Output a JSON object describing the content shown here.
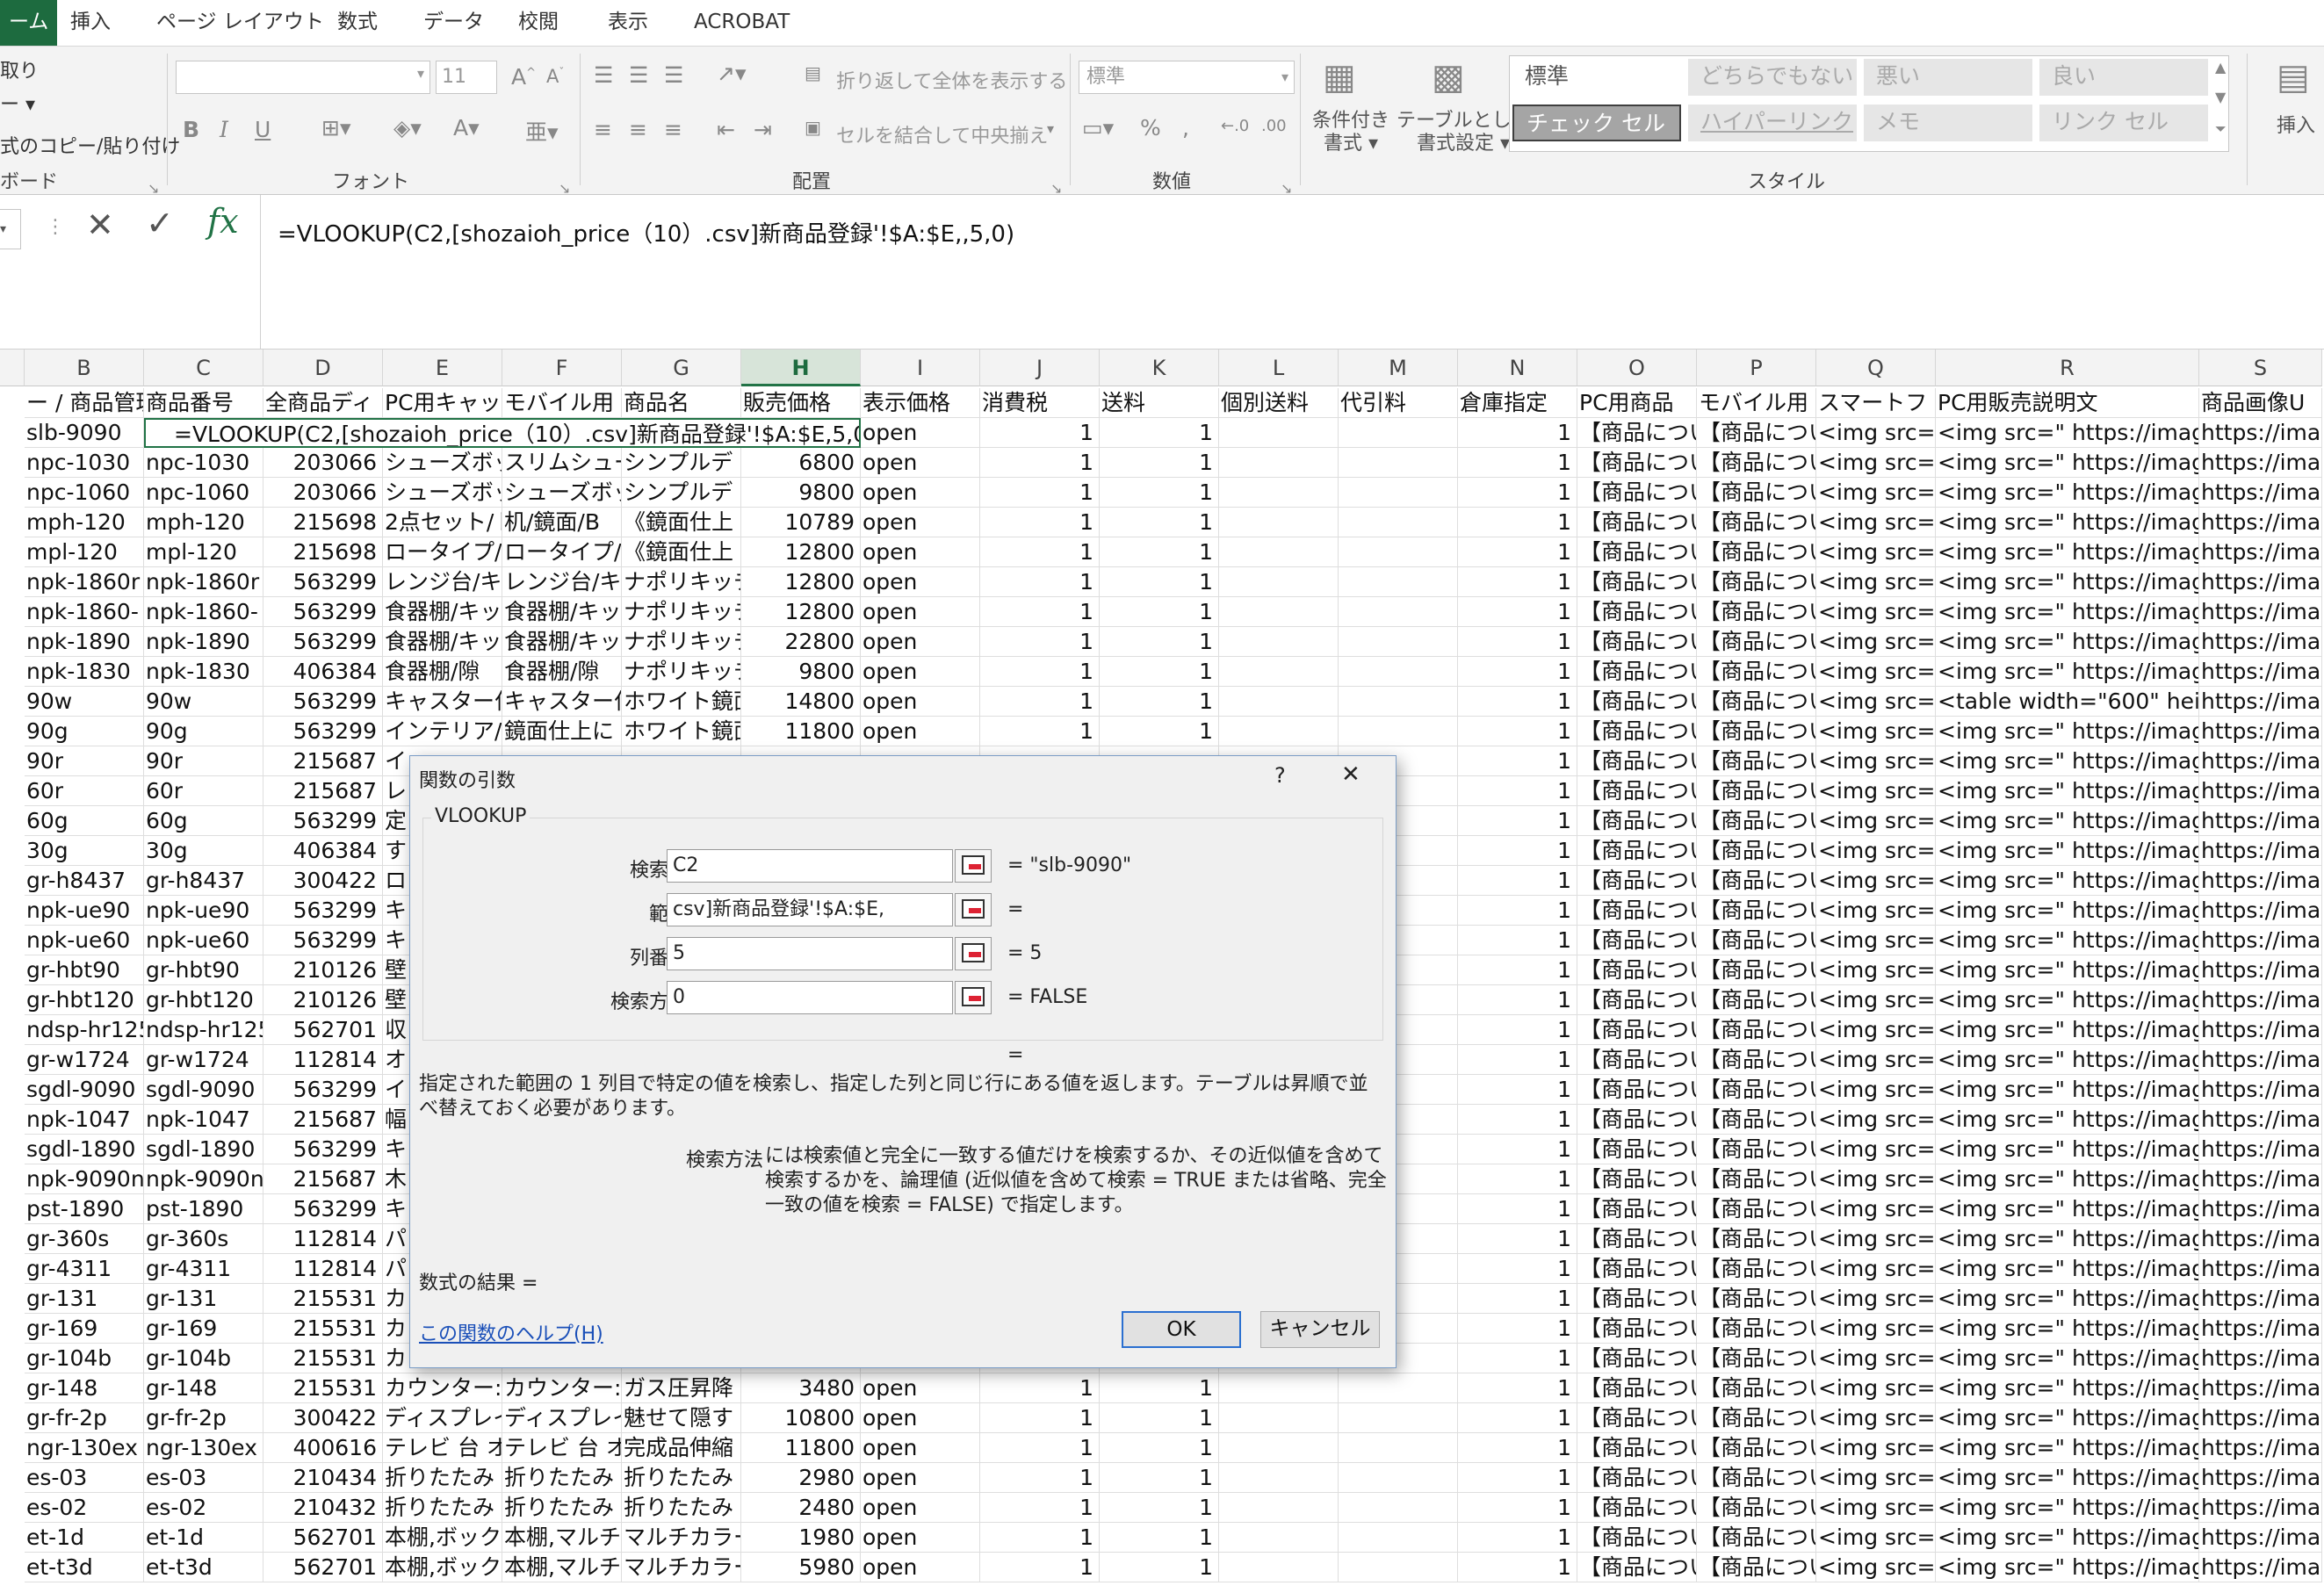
{
  "ribbon": {
    "tabs": [
      {
        "label": "ーム",
        "active": true
      },
      {
        "label": "挿入"
      },
      {
        "label": "ページ レイアウト"
      },
      {
        "label": "数式"
      },
      {
        "label": "データ"
      },
      {
        "label": "校閲"
      },
      {
        "label": "表示"
      },
      {
        "label": "ACROBAT"
      }
    ],
    "clipboard": {
      "cut": "取り",
      "copy": "ー ▾",
      "format_painter": "式のコピー/貼り付け",
      "group": "ボード"
    },
    "font": {
      "font_size": "11",
      "group": "フォント"
    },
    "alignment": {
      "wrap_text": "折り返して全体を表示する",
      "merge_center": "セルを結合して中央揃え",
      "group": "配置"
    },
    "number": {
      "format": "標準",
      "group": "数値"
    },
    "styles": {
      "conditional_formatting": "条件付き\n書式 ▾",
      "format_as_table": "テーブルとして\n書式設定 ▾",
      "cells": [
        "標準",
        "どちらでもない",
        "悪い",
        "良い",
        "チェック セル",
        "ハイパーリンク",
        "メモ",
        "リンク セル"
      ],
      "group": "スタイル"
    },
    "insert": "挿入",
    "colors": {
      "accent": "#217346",
      "bad_bg": "#ffc7ce",
      "good_bg": "#c6efce",
      "check_bg": "#a5a5a5",
      "neutral_bg": "#ffeb9c"
    }
  },
  "formula_bar": {
    "formula": "=VLOOKUP(C2,[shozaioh_price（10）.csv]新商品登録'!$A:$E,,5,0)"
  },
  "sheet": {
    "columns": [
      "B",
      "C",
      "D",
      "E",
      "F",
      "G",
      "H",
      "I",
      "J",
      "K",
      "L",
      "M",
      "N",
      "O",
      "P",
      "Q",
      "R",
      "S"
    ],
    "selected_column": "H",
    "header_row": [
      "ー / 商品管理番",
      "商品番号",
      "全商品ディ",
      "PC用キャッ",
      "モバイル用",
      "商品名",
      "販売価格",
      "表示価格",
      "消費税",
      "送料",
      "個別送料",
      "代引料",
      "倉庫指定",
      "PC用商品",
      "モバイル用",
      "スマートフ",
      "PC用販売説明文",
      "商品画像U"
    ],
    "editing_cell": "=VLOOKUP(C2,[shozaioh_price（10）.csv]新商品登録'!$A:$E,5,0)",
    "rows": [
      [
        "slb-9090",
        "",
        "",
        "",
        "",
        "",
        "",
        "open",
        "1",
        "1",
        "",
        "",
        "1",
        "【商品につい",
        "【商品につい",
        "<img src=\"",
        "<img src=\" https://image",
        "https://ima"
      ],
      [
        "npc-1030",
        "npc-1030",
        "203066",
        "シューズボッ",
        "スリムシュー",
        "シンプルデ",
        "6800",
        "open",
        "1",
        "1",
        "",
        "",
        "1",
        "【商品につい",
        "【商品につい",
        "<img src=\"",
        "<img src=\" https://image",
        "https://ima"
      ],
      [
        "npc-1060",
        "npc-1060",
        "203066",
        "シューズボッ",
        "シューズボッ",
        "シンプルデ",
        "9800",
        "open",
        "1",
        "1",
        "",
        "",
        "1",
        "【商品につい",
        "【商品につい",
        "<img src=\"",
        "<img src=\" https://image",
        "https://ima"
      ],
      [
        "mph-120",
        "mph-120",
        "215698",
        "2点セット/ト",
        "机/鏡面/B",
        "《鏡面仕上",
        "10789",
        "open",
        "1",
        "1",
        "",
        "",
        "1",
        "【商品につい",
        "【商品につい",
        "<img src=\"",
        "<img src=\" https://image",
        "https://ima"
      ],
      [
        "mpl-120",
        "mpl-120",
        "215698",
        "ロータイプ/",
        "ロータイプ/",
        "《鏡面仕上",
        "12800",
        "open",
        "1",
        "1",
        "",
        "",
        "1",
        "【商品につい",
        "【商品につい",
        "<img src=\"",
        "<img src=\" https://image",
        "https://ima"
      ],
      [
        "npk-1860r",
        "npk-1860r",
        "563299",
        "レンジ台/キ",
        "レンジ台/キ",
        "ナポリキッチ",
        "12800",
        "open",
        "1",
        "1",
        "",
        "",
        "1",
        "【商品につい",
        "【商品につい",
        "<img src=\"",
        "<img src=\" https://image",
        "https://ima"
      ],
      [
        "npk-1860-",
        "npk-1860-",
        "563299",
        "食器棚/キッ",
        "食器棚/キッ",
        "ナポリキッチ",
        "12800",
        "open",
        "1",
        "1",
        "",
        "",
        "1",
        "【商品につい",
        "【商品につい",
        "<img src=\"",
        "<img src=\" https://image",
        "https://ima"
      ],
      [
        "npk-1890",
        "npk-1890",
        "563299",
        "食器棚/キッ",
        "食器棚/キッ",
        "ナポリキッチ",
        "22800",
        "open",
        "1",
        "1",
        "",
        "",
        "1",
        "【商品につい",
        "【商品につい",
        "<img src=\"",
        "<img src=\" https://image",
        "https://ima"
      ],
      [
        "npk-1830",
        "npk-1830",
        "406384",
        "食器棚/隙",
        "食器棚/隙",
        "ナポリキッチ",
        "9800",
        "open",
        "1",
        "1",
        "",
        "",
        "1",
        "【商品につい",
        "【商品につい",
        "<img src=\"",
        "<img src=\" https://image",
        "https://ima"
      ],
      [
        "90w",
        "90w",
        "563299",
        "キャスター付",
        "キャスター付",
        "ホワイト鏡面",
        "14800",
        "open",
        "1",
        "1",
        "",
        "",
        "1",
        "【商品につい",
        "【商品につい",
        "<img src=\"",
        "<table width=\"600\" heig",
        "https://ima"
      ],
      [
        "90g",
        "90g",
        "563299",
        "インテリア/",
        "鏡面仕上に",
        "ホワイト鏡面",
        "11800",
        "open",
        "1",
        "1",
        "",
        "",
        "1",
        "【商品につい",
        "【商品につい",
        "<img src=\"",
        "<img src=\" https://image",
        "https://ima"
      ],
      [
        "90r",
        "90r",
        "215687",
        "イ",
        "",
        "",
        "",
        "",
        "",
        "",
        "",
        "",
        "1",
        "【商品につい",
        "【商品につい",
        "<img src=\"",
        "<img src=\" https://image",
        "https://ima"
      ],
      [
        "60r",
        "60r",
        "215687",
        "レ",
        "",
        "",
        "",
        "",
        "",
        "",
        "",
        "",
        "1",
        "【商品につい",
        "【商品につい",
        "<img src=\"",
        "<img src=\" https://image",
        "https://ima"
      ],
      [
        "60g",
        "60g",
        "563299",
        "定",
        "",
        "",
        "",
        "",
        "",
        "",
        "",
        "",
        "1",
        "【商品につい",
        "【商品につい",
        "<img src=\"",
        "<img src=\" https://image",
        "https://ima"
      ],
      [
        "30g",
        "30g",
        "406384",
        "す",
        "",
        "",
        "",
        "",
        "",
        "",
        "",
        "",
        "1",
        "【商品につい",
        "【商品につい",
        "<img src=\"",
        "<img src=\" https://image",
        "https://ima"
      ],
      [
        "gr-h8437",
        "gr-h8437",
        "300422",
        "ロ",
        "",
        "",
        "",
        "",
        "",
        "",
        "",
        "",
        "1",
        "【商品につい",
        "【商品につい",
        "<img src=\"",
        "<img src=\" https://image",
        "https://ima"
      ],
      [
        "npk-ue90",
        "npk-ue90",
        "563299",
        "キ",
        "",
        "",
        "",
        "",
        "",
        "",
        "",
        "",
        "1",
        "【商品につい",
        "【商品につい",
        "<img src=\"",
        "<img src=\" https://image",
        "https://ima"
      ],
      [
        "npk-ue60",
        "npk-ue60",
        "563299",
        "キ",
        "",
        "",
        "",
        "",
        "",
        "",
        "",
        "",
        "1",
        "【商品につい",
        "【商品につい",
        "<img src=\"",
        "<img src=\" https://image",
        "https://ima"
      ],
      [
        "gr-hbt90",
        "gr-hbt90",
        "210126",
        "壁",
        "",
        "",
        "",
        "",
        "",
        "",
        "",
        "",
        "1",
        "【商品につい",
        "【商品につい",
        "<img src=\"",
        "<img src=\" https://image",
        "https://ima"
      ],
      [
        "gr-hbt120",
        "gr-hbt120",
        "210126",
        "壁",
        "",
        "",
        "",
        "",
        "",
        "",
        "",
        "",
        "1",
        "【商品につい",
        "【商品につい",
        "<img src=\"",
        "<img src=\" https://image",
        "https://ima"
      ],
      [
        "ndsp-hr125",
        "ndsp-hr125",
        "562701",
        "収",
        "",
        "",
        "",
        "",
        "",
        "",
        "",
        "",
        "1",
        "【商品につい",
        "【商品につい",
        "<img src=\"",
        "<img src=\" https://image",
        "https://ima"
      ],
      [
        "gr-w1724",
        "gr-w1724",
        "112814",
        "オ",
        "",
        "",
        "",
        "",
        "",
        "",
        "",
        "",
        "1",
        "【商品につい",
        "【商品につい",
        "<img src=\"",
        "<img src=\" https://image",
        "https://ima"
      ],
      [
        "sgdl-9090",
        "sgdl-9090",
        "563299",
        "イ",
        "",
        "",
        "",
        "",
        "",
        "",
        "",
        "",
        "1",
        "【商品につい",
        "【商品につい",
        "<img src=\"",
        "<img src=\" https://image",
        "https://ima"
      ],
      [
        "npk-1047",
        "npk-1047",
        "215687",
        "幅",
        "",
        "",
        "",
        "",
        "",
        "",
        "",
        "",
        "1",
        "【商品につい",
        "【商品につい",
        "<img src=\"",
        "<img src=\" https://image",
        "https://ima"
      ],
      [
        "sgdl-1890",
        "sgdl-1890",
        "563299",
        "キ",
        "",
        "",
        "",
        "",
        "",
        "",
        "",
        "",
        "1",
        "【商品につい",
        "【商品につい",
        "<img src=\"",
        "<img src=\" https://image",
        "https://ima"
      ],
      [
        "npk-9090n",
        "npk-9090n",
        "215687",
        "木",
        "",
        "",
        "",
        "",
        "",
        "",
        "",
        "",
        "1",
        "【商品につい",
        "【商品につい",
        "<img src=\"",
        "<img src=\" https://image",
        "https://ima"
      ],
      [
        "pst-1890",
        "pst-1890",
        "563299",
        "キ",
        "",
        "",
        "",
        "",
        "",
        "",
        "",
        "",
        "1",
        "【商品につい",
        "【商品につい",
        "<img src=\"",
        "<img src=\" https://image",
        "https://ima"
      ],
      [
        "gr-360s",
        "gr-360s",
        "112814",
        "パ",
        "",
        "",
        "",
        "",
        "",
        "",
        "",
        "",
        "1",
        "【商品につい",
        "【商品につい",
        "<img src=\"",
        "<img src=\" https://image",
        "https://ima"
      ],
      [
        "gr-4311",
        "gr-4311",
        "112814",
        "パ",
        "",
        "",
        "",
        "",
        "",
        "",
        "",
        "",
        "1",
        "【商品につい",
        "【商品につい",
        "<img src=\"",
        "<img src=\" https://image",
        "https://ima"
      ],
      [
        "gr-131",
        "gr-131",
        "215531",
        "カ",
        "",
        "",
        "",
        "",
        "",
        "",
        "",
        "",
        "1",
        "【商品につい",
        "【商品につい",
        "<img src=\"",
        "<img src=\" https://image",
        "https://ima"
      ],
      [
        "gr-169",
        "gr-169",
        "215531",
        "カ",
        "",
        "",
        "",
        "",
        "",
        "",
        "",
        "",
        "1",
        "【商品につい",
        "【商品につい",
        "<img src=\"",
        "<img src=\" https://image",
        "https://ima"
      ],
      [
        "gr-104b",
        "gr-104b",
        "215531",
        "カ",
        "",
        "",
        "",
        "",
        "",
        "",
        "",
        "",
        "1",
        "【商品につい",
        "【商品につい",
        "<img src=\"",
        "<img src=\" https://image",
        "https://ima"
      ],
      [
        "gr-148",
        "gr-148",
        "215531",
        "カウンター:",
        "カウンター:",
        "ガス圧昇降",
        "3480",
        "open",
        "1",
        "1",
        "",
        "",
        "1",
        "【商品につい",
        "【商品につい",
        "<img src=\"",
        "<img src=\" https://image",
        "https://ima"
      ],
      [
        "gr-fr-2p",
        "gr-fr-2p",
        "300422",
        "ディスプレイ",
        "ディスプレイ",
        "魅せて隠す",
        "10800",
        "open",
        "1",
        "1",
        "",
        "",
        "1",
        "【商品につい",
        "【商品につい",
        "<img src=\"",
        "<img src=\" https://image",
        "https://ima"
      ],
      [
        "ngr-130ex",
        "ngr-130ex",
        "400616",
        "テレビ 台 オ",
        "テレビ 台 オ",
        "完成品伸縮",
        "11800",
        "open",
        "1",
        "1",
        "",
        "",
        "1",
        "【商品につい",
        "【商品につい",
        "<img src=\"",
        "<img src=\" https://image",
        "https://ima"
      ],
      [
        "es-03",
        "es-03",
        "210434",
        "折りたたみ",
        "折りたたみ",
        "折りたたみ",
        "2980",
        "open",
        "1",
        "1",
        "",
        "",
        "1",
        "【商品につい",
        "【商品につい",
        "<img src=\"",
        "<img src=\" https://image",
        "https://ima"
      ],
      [
        "es-02",
        "es-02",
        "210432",
        "折りたたみ",
        "折りたたみ",
        "折りたたみ",
        "2480",
        "open",
        "1",
        "1",
        "",
        "",
        "1",
        "【商品につい",
        "【商品につい",
        "<img src=\"",
        "<img src=\" https://image",
        "https://ima"
      ],
      [
        "et-1d",
        "et-1d",
        "562701",
        "本棚,ボック",
        "本棚,マルチ",
        "マルチカラー",
        "1980",
        "open",
        "1",
        "1",
        "",
        "",
        "1",
        "【商品につい",
        "【商品につい",
        "<img src=\"",
        "<img src=\" https://image",
        "https://ima"
      ],
      [
        "et-t3d",
        "et-t3d",
        "562701",
        "本棚,ボック",
        "本棚,マルチ",
        "マルチカラー",
        "5980",
        "open",
        "1",
        "1",
        "",
        "",
        "1",
        "【商品につい",
        "【商品につい",
        "<img src=\"",
        "<img src=\" https://image",
        "https://ima"
      ]
    ]
  },
  "dialog": {
    "title": "関数の引数",
    "help": "?",
    "close": "✕",
    "function_name": "VLOOKUP",
    "args": [
      {
        "label": "検索値",
        "value": "C2",
        "result": "=  \"slb-9090\""
      },
      {
        "label": "範囲",
        "value": "csv]新商品登録'!$A:$E,",
        "result": "="
      },
      {
        "label": "列番号",
        "value": "5",
        "result": "=  5"
      },
      {
        "label": "検索方法",
        "value": "0",
        "result": "=  FALSE"
      }
    ],
    "overall_result": "=",
    "description": "指定された範囲の 1 列目で特定の値を検索し、指定した列と同じ行にある値を返します。テーブルは昇順で並べ替えておく必要があります。",
    "arg_help_name": "検索方法",
    "arg_help_text": "には検索値と完全に一致する値だけを検索するか、その近似値を含めて検索するかを、論理値 (近似値を含めて検索 = TRUE または省略、完全一致の値を検索 = FALSE) で指定します。",
    "formula_result": "数式の結果 =",
    "help_link": "この関数のヘルプ(H)",
    "ok": "OK",
    "cancel": "キャンセル"
  }
}
